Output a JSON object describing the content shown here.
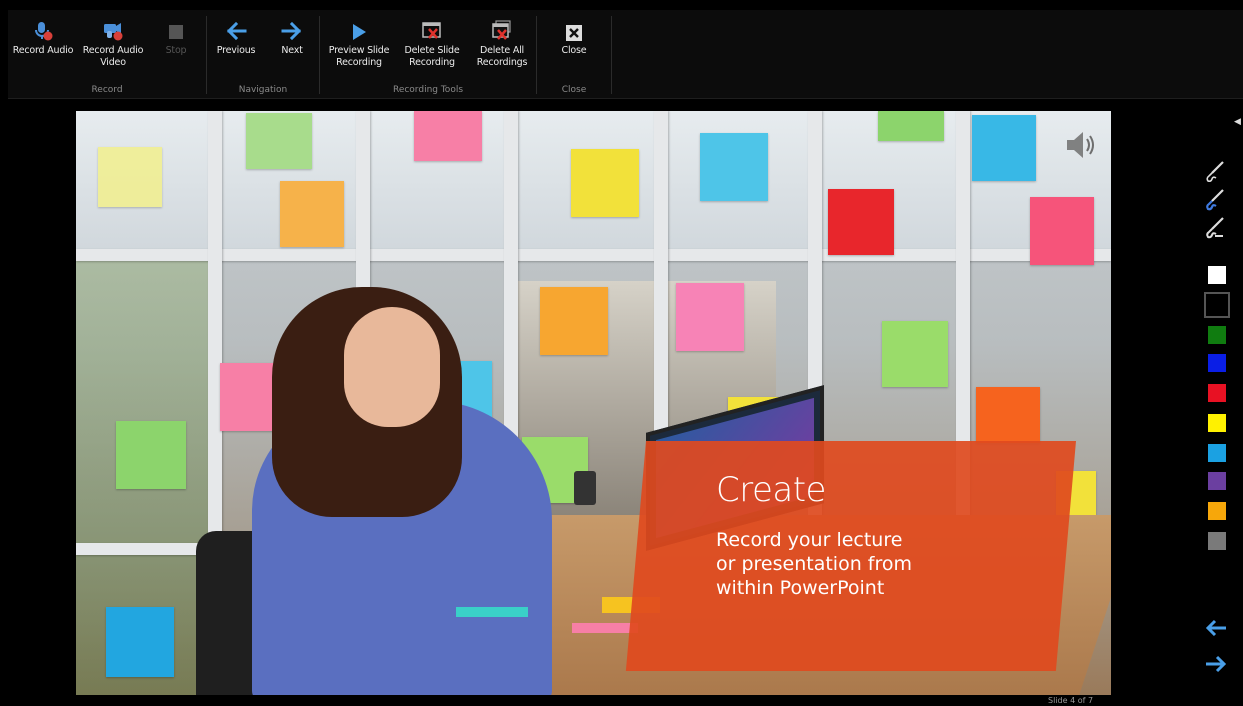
{
  "ribbon": {
    "groups": {
      "record": "Record",
      "navigation": "Navigation",
      "recording_tools": "Recording Tools",
      "close": "Close"
    },
    "buttons": {
      "record_audio": "Record Audio",
      "record_audio_video": "Record Audio\nVideo",
      "stop": "Stop",
      "previous": "Previous",
      "next": "Next",
      "preview_slide_recording": "Preview Slide\nRecording",
      "delete_slide_recording": "Delete Slide\nRecording",
      "delete_all_recordings": "Delete All\nRecordings",
      "close": "Close"
    }
  },
  "slide": {
    "title": "Create",
    "body": "Record your lecture\nor presentation from\nwithin PowerPoint",
    "accent_color": "#e04a1e"
  },
  "pen_tools": [
    "pen-icon",
    "highlighter-icon",
    "eraser-icon"
  ],
  "ink_colors": [
    {
      "name": "white",
      "hex": "#ffffff"
    },
    {
      "name": "black",
      "hex": "#000000",
      "selected": true
    },
    {
      "name": "green",
      "hex": "#107c10"
    },
    {
      "name": "blue",
      "hex": "#0a1ee6"
    },
    {
      "name": "red",
      "hex": "#e81123"
    },
    {
      "name": "yellow",
      "hex": "#fff100"
    },
    {
      "name": "light-blue",
      "hex": "#1ba1e2"
    },
    {
      "name": "purple",
      "hex": "#6b3fa0"
    },
    {
      "name": "orange",
      "hex": "#f7a70a"
    },
    {
      "name": "gray",
      "hex": "#7a7a7a"
    }
  ],
  "status": {
    "slide_counter": "Slide 4 of 7"
  }
}
